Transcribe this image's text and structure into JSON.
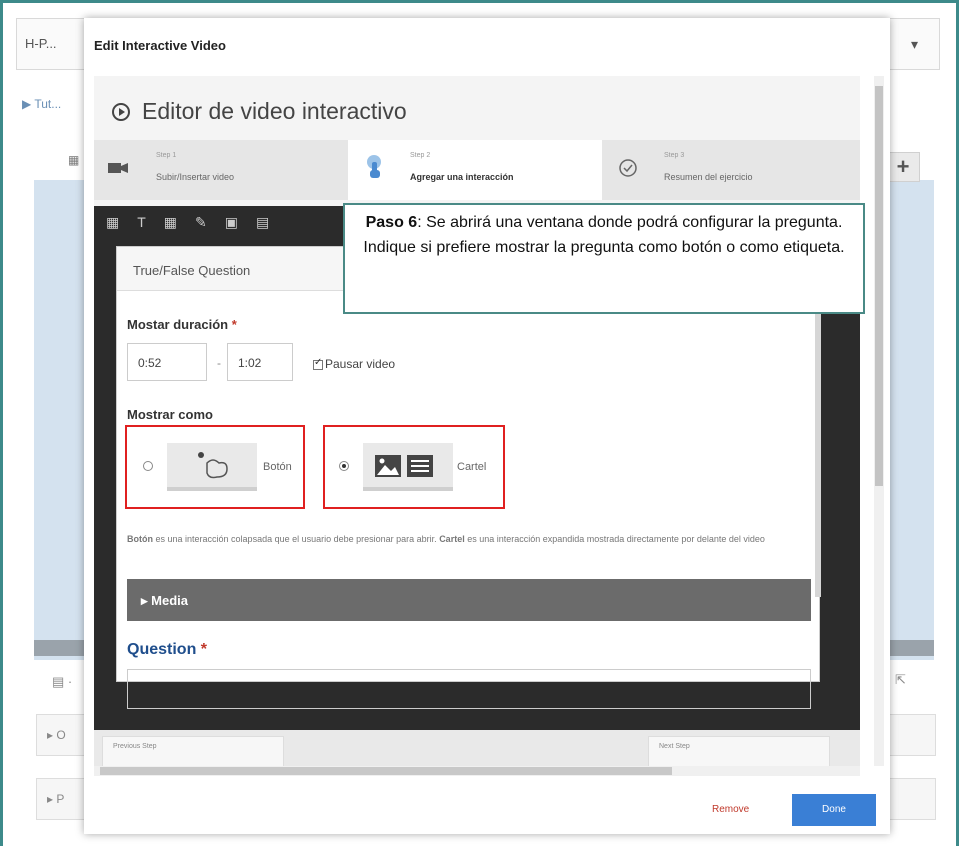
{
  "background": {
    "app_label": "H-P...",
    "breadcrumb": "Tut...",
    "row1_label": "O",
    "row2_label": "P"
  },
  "modal": {
    "title": "Edit Interactive Video",
    "remove_label": "Remove",
    "done_label": "Done"
  },
  "editor": {
    "title": "Editor de video interactivo",
    "steps": [
      {
        "small": "Step 1",
        "label": "Subir/Insertar video",
        "icon": "video-camera-icon"
      },
      {
        "small": "Step 2",
        "label": "Agregar una interacción",
        "icon": "hand-pointer-icon"
      },
      {
        "small": "Step 3",
        "label": "Resumen del ejercicio",
        "icon": "check-circle-icon"
      }
    ],
    "prev_label": "Previous Step",
    "next_label": "Next Step"
  },
  "tf_dialog": {
    "title": "True/False Question",
    "duration_label": "Mostar duración",
    "required_mark": "*",
    "start_time": "0:52",
    "end_time": "1:02",
    "pause_label": "Pausar video",
    "display_label": "Mostrar como",
    "option_button": "Botón",
    "option_poster": "Cartel",
    "desc_bold_1": "Botón",
    "desc_text_1": " es una interacción colapsada que el usuario debe presionar para abrir. ",
    "desc_bold_2": "Cartel",
    "desc_text_2": " es una interacción expandida mostrada directamente por delante del video",
    "media_label": "Media",
    "question_label": "Question"
  },
  "callout": {
    "bold": "Paso 6",
    "text": ": Se abrirá una ventana donde podrá configurar la pregunta. Indique si prefiere mostrar la pregunta como botón o como etiqueta."
  },
  "colors": {
    "frame": "#3d8a8a",
    "highlight": "#e02020",
    "done_button": "#3a7fd5",
    "question": "#1f4e8c"
  }
}
